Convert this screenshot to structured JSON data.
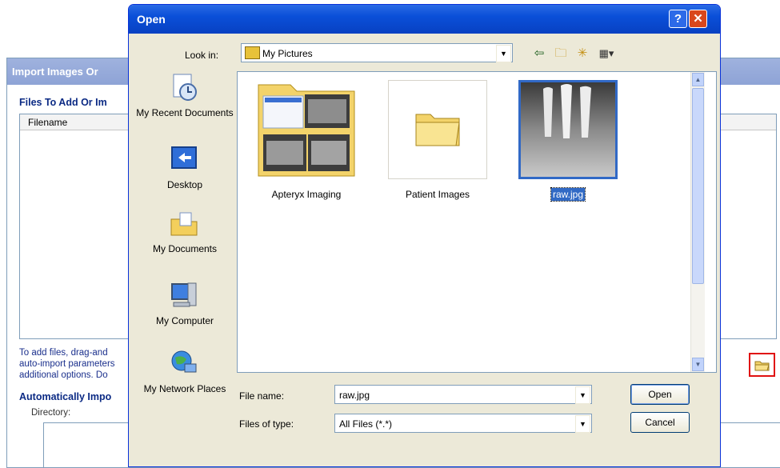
{
  "background": {
    "title": "Import Images Or",
    "files_label": "Files To Add Or Im",
    "column_filename": "Filename",
    "help_lines": [
      "To add files, drag-and",
      "auto-import parameters",
      "additional options.  Do"
    ],
    "auto_label": "Automatically Impo",
    "directory_label": "Directory:"
  },
  "dialog": {
    "title": "Open",
    "help_glyph": "?",
    "close_glyph": "✕",
    "look_in_label": "Look in:",
    "look_in_value": "My Pictures",
    "places": [
      {
        "label": "My Recent Documents",
        "icon": "recent-documents-icon"
      },
      {
        "label": "Desktop",
        "icon": "desktop-icon"
      },
      {
        "label": "My Documents",
        "icon": "my-documents-icon"
      },
      {
        "label": "My Computer",
        "icon": "my-computer-icon"
      },
      {
        "label": "My Network Places",
        "icon": "network-places-icon"
      }
    ],
    "files": [
      {
        "name": "Apteryx Imaging",
        "icon": "folder-with-thumbnails-icon",
        "selected": false
      },
      {
        "name": "Patient Images",
        "icon": "folder-icon",
        "selected": false
      },
      {
        "name": "raw.jpg",
        "icon": "xray-thumbnail",
        "selected": true
      }
    ],
    "file_name_label": "File name:",
    "file_name_value": "raw.jpg",
    "files_of_type_label": "Files of type:",
    "files_of_type_value": "All Files (*.*)",
    "open_label": "Open",
    "cancel_label": "Cancel"
  }
}
